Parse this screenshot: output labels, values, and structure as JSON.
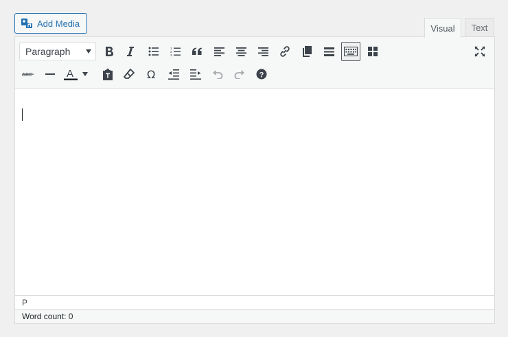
{
  "add_media": {
    "label": "Add Media"
  },
  "tabs": [
    {
      "label": "Visual",
      "active": true
    },
    {
      "label": "Text",
      "active": false
    }
  ],
  "toolbar": {
    "format_select": {
      "value": "Paragraph"
    },
    "row1": [
      "bold-icon",
      "italic-icon",
      "bulleted-list-icon",
      "numbered-list-icon",
      "blockquote-icon",
      "align-left-icon",
      "align-center-icon",
      "align-right-icon",
      "link-icon",
      "read-more-icon",
      "toolbar-toggle-icon",
      "block-grid-icon",
      "fullscreen-icon"
    ],
    "row2": [
      "strikethrough-icon",
      "horizontal-line-icon",
      "text-color-icon",
      "paste-as-text-icon",
      "clear-formatting-icon",
      "special-character-icon",
      "outdent-icon",
      "indent-icon",
      "undo-icon",
      "redo-icon",
      "help-icon"
    ],
    "strike_glyph": "ABC",
    "text_color_glyph": "A",
    "omega_glyph": "Ω",
    "help_glyph": "?"
  },
  "statusbar": {
    "path": "P"
  },
  "footer": {
    "word_count_label": "Word count: 0"
  },
  "colors": {
    "accent": "#2271b1",
    "toolbar_bg": "#f6f7f7",
    "border": "#dcdcde",
    "icon": "#3c434a",
    "disabled_icon": "#a7aaad"
  }
}
